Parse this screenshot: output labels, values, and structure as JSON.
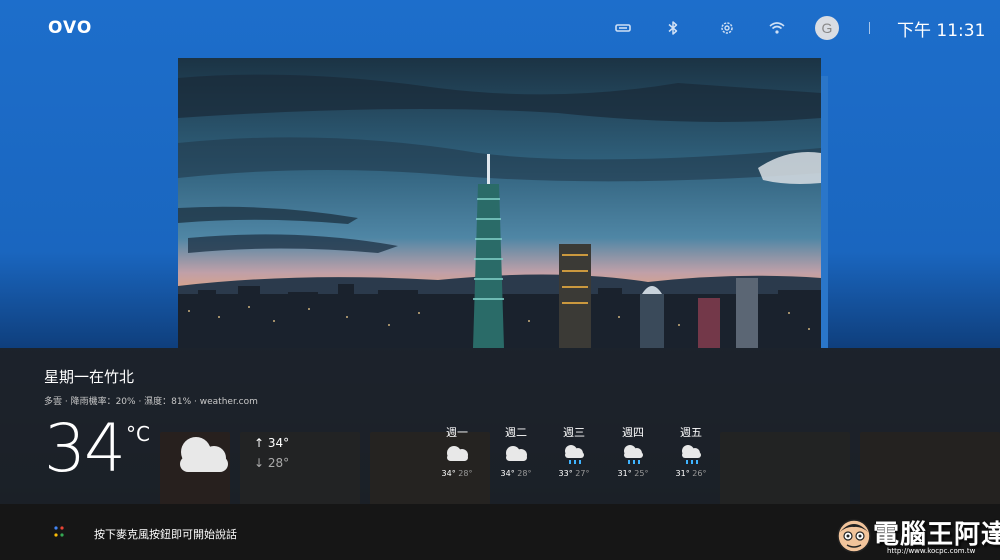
{
  "topbar": {
    "logo": "OVO",
    "clock": "下午 11:31",
    "avatar_letter": "G",
    "icons": [
      "hdmi-input-icon",
      "bluetooth-icon",
      "gear-icon",
      "wifi-icon"
    ]
  },
  "weather": {
    "location": "星期一在竹北",
    "conditions": "多雲 · 降雨機率：20% · 濕度：81% · weather.com",
    "temperature": "34",
    "unit": "°C",
    "high": "↑ 34°",
    "low": "↓ 28°",
    "icon": "cloudy-icon"
  },
  "forecast": [
    {
      "day": "週一",
      "high": "34°",
      "low": "28°",
      "icon": "cloudy-icon"
    },
    {
      "day": "週二",
      "high": "34°",
      "low": "28°",
      "icon": "cloudy-icon"
    },
    {
      "day": "週三",
      "high": "33°",
      "low": "27°",
      "icon": "rain-icon"
    },
    {
      "day": "週四",
      "high": "31°",
      "low": "25°",
      "icon": "rain-icon"
    },
    {
      "day": "週五",
      "high": "31°",
      "low": "26°",
      "icon": "rain-icon"
    }
  ],
  "assistant": {
    "hint": "按下麥克風按鈕即可開始說話"
  },
  "watermark": {
    "text": "電腦王阿達",
    "url": "http://www.kocpc.com.tw"
  },
  "colors": {
    "background_blue": "#1d6ecb",
    "panel": "#1e1e1e",
    "rain_blue": "#3fb4ff",
    "assistant_blue": "#4285f4",
    "assistant_red": "#ea4335",
    "assistant_yellow": "#fbbc05",
    "assistant_green": "#34a853"
  }
}
